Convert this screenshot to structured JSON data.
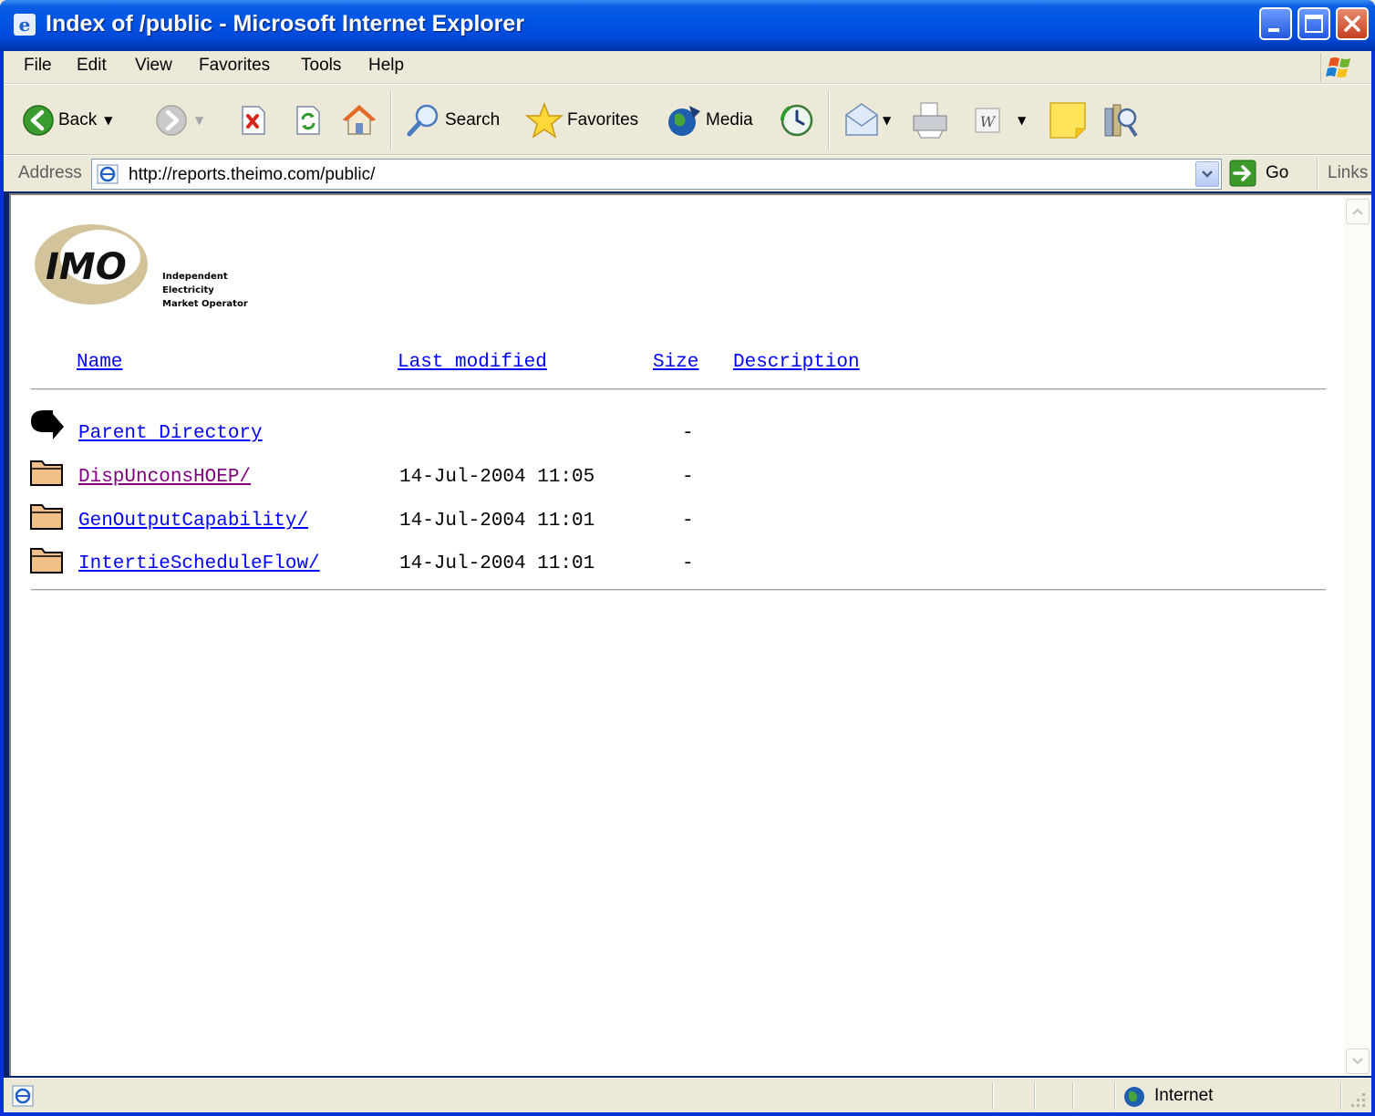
{
  "window": {
    "title": "Index of /public - Microsoft Internet Explorer"
  },
  "menu": [
    "File",
    "Edit",
    "View",
    "Favorites",
    "Tools",
    "Help"
  ],
  "toolbar": {
    "back_label": "Back",
    "search_label": "Search",
    "favorites_label": "Favorites",
    "media_label": "Media"
  },
  "address": {
    "label": "Address",
    "url": "http://reports.theimo.com/public/",
    "go_label": "Go",
    "links_label": "Links"
  },
  "logo": {
    "mark": "IMO",
    "tagline": [
      "Independent",
      "Electricity",
      "Market Operator"
    ]
  },
  "listing": {
    "headers": {
      "name": "Name",
      "modified": "Last modified",
      "size": "Size",
      "description": "Description"
    },
    "rows": [
      {
        "icon": "parent-arrow-icon",
        "name": "Parent Directory",
        "modified": "",
        "size": "-",
        "visited": false
      },
      {
        "icon": "folder-icon",
        "name": "DispUnconsHOEP/",
        "modified": "14-Jul-2004 11:05",
        "size": "-",
        "visited": true
      },
      {
        "icon": "folder-icon",
        "name": "GenOutputCapability/",
        "modified": "14-Jul-2004 11:01",
        "size": "-",
        "visited": false
      },
      {
        "icon": "folder-icon",
        "name": "IntertieScheduleFlow/",
        "modified": "14-Jul-2004 11:01",
        "size": "-",
        "visited": false
      }
    ]
  },
  "status": {
    "zone": "Internet"
  },
  "colors": {
    "link": "#0000ff",
    "visited": "#800080",
    "titlebar": "#0055e5",
    "chrome": "#ece9d8"
  }
}
